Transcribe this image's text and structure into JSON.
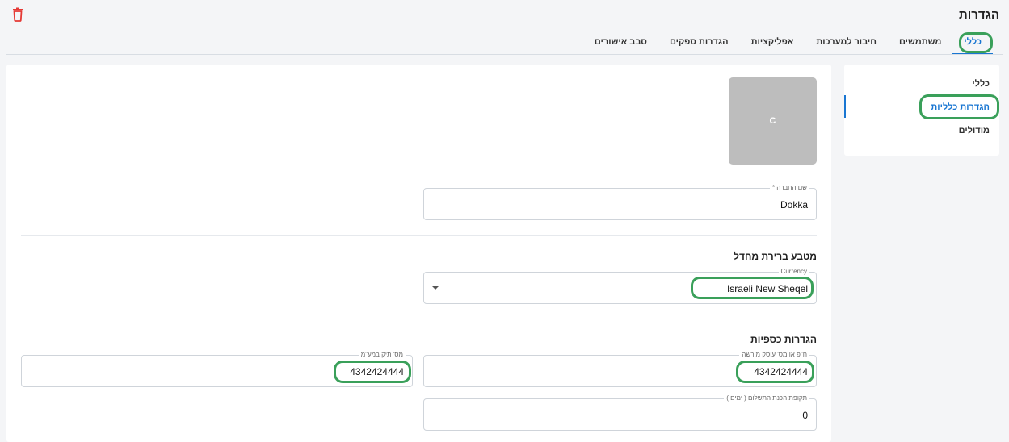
{
  "header": {
    "title": "הגדרות"
  },
  "tabs": [
    {
      "label": "כללי",
      "active": true
    },
    {
      "label": "משתמשים"
    },
    {
      "label": "חיבור למערכות"
    },
    {
      "label": "אפליקציות"
    },
    {
      "label": "הגדרות ספקים"
    },
    {
      "label": "סבב אישורים"
    }
  ],
  "sidebar": {
    "items": [
      {
        "label": "כללי"
      },
      {
        "label": "הגדרות כלליות",
        "active": true
      },
      {
        "label": "מודולים"
      }
    ]
  },
  "logo": {
    "letter": "C"
  },
  "company": {
    "name_label": "שם החברה *",
    "name_value": "Dokka"
  },
  "currency_section": {
    "title": "מטבע ברירת מחדל",
    "currency_label": "Currency",
    "currency_value": "Israeli New Sheqel"
  },
  "finance_section": {
    "title": "הגדרות כספיות",
    "tax_id_label": "ח\"פ או מס' עוסק מורשה",
    "tax_id_value": "4342424444",
    "vat_file_label": "מס' תיק במע\"מ",
    "vat_file_value": "4342424444",
    "payment_terms_label": "תקופת הכנת התשלום ( ימים )",
    "payment_terms_value": "0"
  },
  "colors": {
    "accent": "#1976d2",
    "highlight": "#3aa05a",
    "danger": "#e53935"
  },
  "icons": {
    "delete": "trash-icon",
    "dropdown": "caret-down-icon"
  }
}
